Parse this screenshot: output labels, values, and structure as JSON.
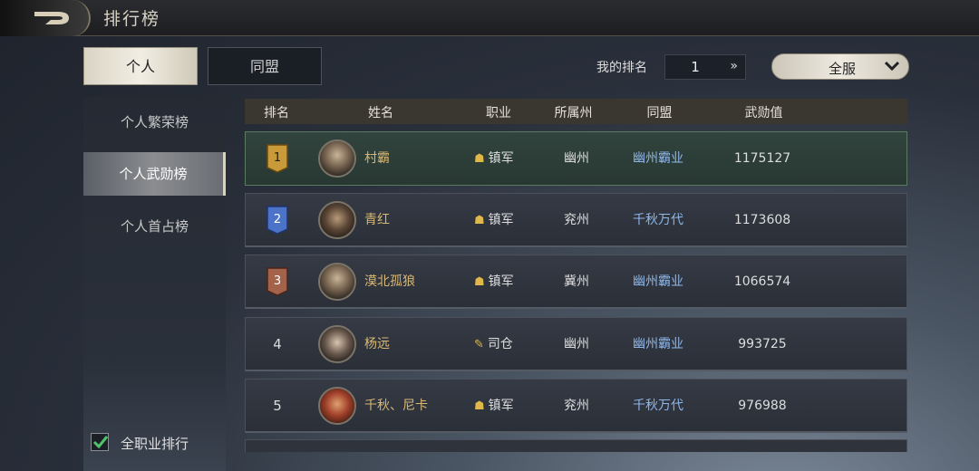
{
  "header": {
    "title": "排行榜"
  },
  "tabs": [
    {
      "label": "个人"
    },
    {
      "label": "同盟"
    }
  ],
  "my_rank": {
    "label": "我的排名",
    "value": "1",
    "arrow": "»"
  },
  "server_dropdown": {
    "selected": "全服"
  },
  "sidebar": {
    "items": [
      {
        "label": "个人繁荣榜"
      },
      {
        "label": "个人武勋榜"
      },
      {
        "label": "个人首占榜"
      }
    ]
  },
  "filter": {
    "label": "全职业排行",
    "checked": true
  },
  "table": {
    "columns": [
      "排名",
      "姓名",
      "职业",
      "所属州",
      "同盟",
      "武勋值"
    ],
    "rows": [
      {
        "rank": "1",
        "name": "村霸",
        "job": "镇军",
        "state": "幽州",
        "alliance": "幽州霸业",
        "value": "1175127"
      },
      {
        "rank": "2",
        "name": "青红",
        "job": "镇军",
        "state": "兖州",
        "alliance": "千秋万代",
        "value": "1173608"
      },
      {
        "rank": "3",
        "name": "漠北孤狼",
        "job": "镇军",
        "state": "冀州",
        "alliance": "幽州霸业",
        "value": "1066574"
      },
      {
        "rank": "4",
        "name": "杨远",
        "job": "司仓",
        "state": "幽州",
        "alliance": "幽州霸业",
        "value": "993725"
      },
      {
        "rank": "5",
        "name": "千秋、尼卡",
        "job": "镇军",
        "state": "兖州",
        "alliance": "千秋万代",
        "value": "976988"
      }
    ]
  },
  "colors": {
    "gold": "#c89a3a",
    "blue": "#4b73c7",
    "bronze": "#a3624a",
    "alliance_text": "#8fb7ea",
    "name_text": "#d9b873"
  },
  "icons": {
    "back": "back-arrow-icon",
    "job": "helmet-icon",
    "check": "checkmark-icon",
    "chevron": "chevron-down-icon"
  }
}
